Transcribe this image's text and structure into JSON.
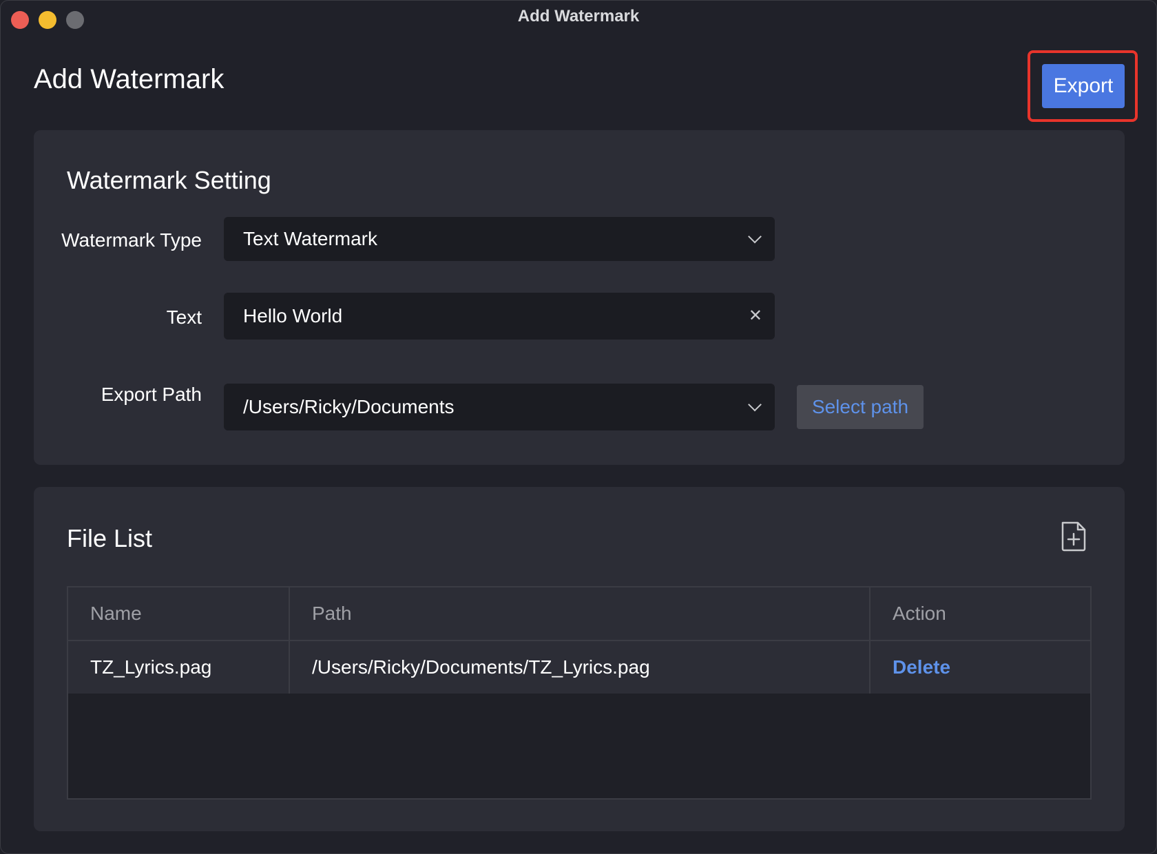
{
  "window": {
    "title": "Add Watermark"
  },
  "header": {
    "page_title": "Add Watermark",
    "export_label": "Export"
  },
  "settings": {
    "title": "Watermark Setting",
    "watermark_type": {
      "label": "Watermark Type",
      "value": "Text Watermark"
    },
    "text": {
      "label": "Text",
      "value": "Hello World"
    },
    "export_path": {
      "label": "Export Path",
      "value": "/Users/Ricky/Documents",
      "button_label": "Select path"
    }
  },
  "file_list": {
    "title": "File List",
    "columns": [
      "Name",
      "Path",
      "Action"
    ],
    "rows": [
      {
        "name": "TZ_Lyrics.pag",
        "path": "/Users/Ricky/Documents/TZ_Lyrics.pag",
        "action": "Delete"
      }
    ]
  },
  "colors": {
    "accent": "#4a77e1",
    "link": "#5e92ea",
    "highlight_frame": "#e8342b"
  },
  "icons": {
    "add_file": "file-plus-icon",
    "clear": "close-icon",
    "dropdown": "chevron-down-icon"
  }
}
